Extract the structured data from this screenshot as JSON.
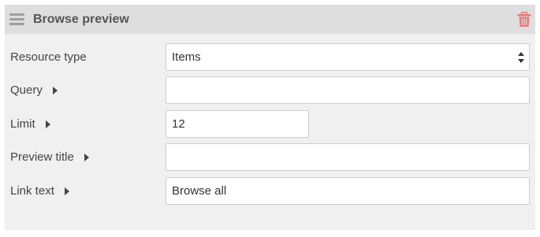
{
  "panel": {
    "title": "Browse preview",
    "drag_icon": "hamburger-icon",
    "delete_icon": "trash-icon",
    "colors": {
      "header_bg": "#dedede",
      "body_bg": "#f0f0f0",
      "delete_icon": "#e07b7b"
    }
  },
  "fields": {
    "resource_type": {
      "label": "Resource type",
      "value": "Items"
    },
    "query": {
      "label": "Query",
      "value": ""
    },
    "limit": {
      "label": "Limit",
      "value": "12"
    },
    "preview_title": {
      "label": "Preview title",
      "value": ""
    },
    "link_text": {
      "label": "Link text",
      "value": "Browse all"
    }
  }
}
